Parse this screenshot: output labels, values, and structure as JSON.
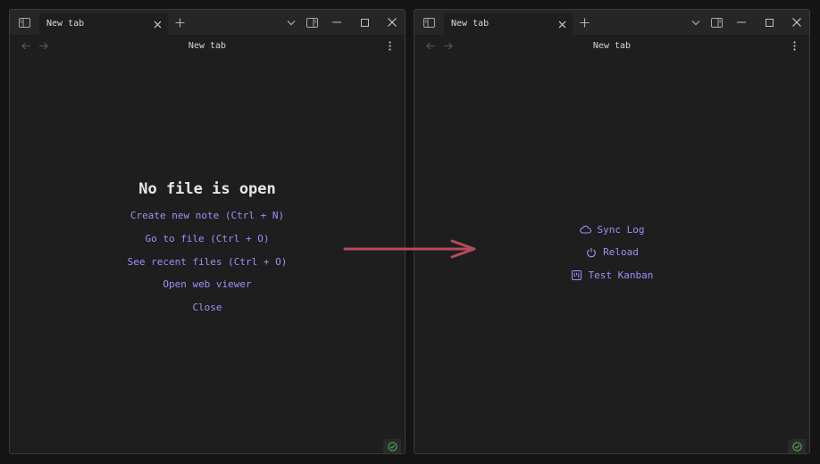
{
  "colors": {
    "background": "#141414",
    "window": "#1e1e1e",
    "titlebar": "#262626",
    "accent": "#a88bfa",
    "arrow": "#b44b5a",
    "status_ok": "#4caf50"
  },
  "left_window": {
    "tab_title": "New tab",
    "nav_title": "New tab",
    "empty_title": "No file is open",
    "actions": [
      {
        "label": "Create new note (Ctrl + N)"
      },
      {
        "label": "Go to file (Ctrl + O)"
      },
      {
        "label": "See recent files (Ctrl + O)"
      },
      {
        "label": "Open web viewer"
      },
      {
        "label": "Close"
      }
    ]
  },
  "right_window": {
    "tab_title": "New tab",
    "nav_title": "New tab",
    "commands": [
      {
        "label": "Sync Log",
        "icon": "cloud-icon"
      },
      {
        "label": "Reload",
        "icon": "power-icon"
      },
      {
        "label": "Test Kanban",
        "icon": "kanban-icon"
      }
    ]
  }
}
